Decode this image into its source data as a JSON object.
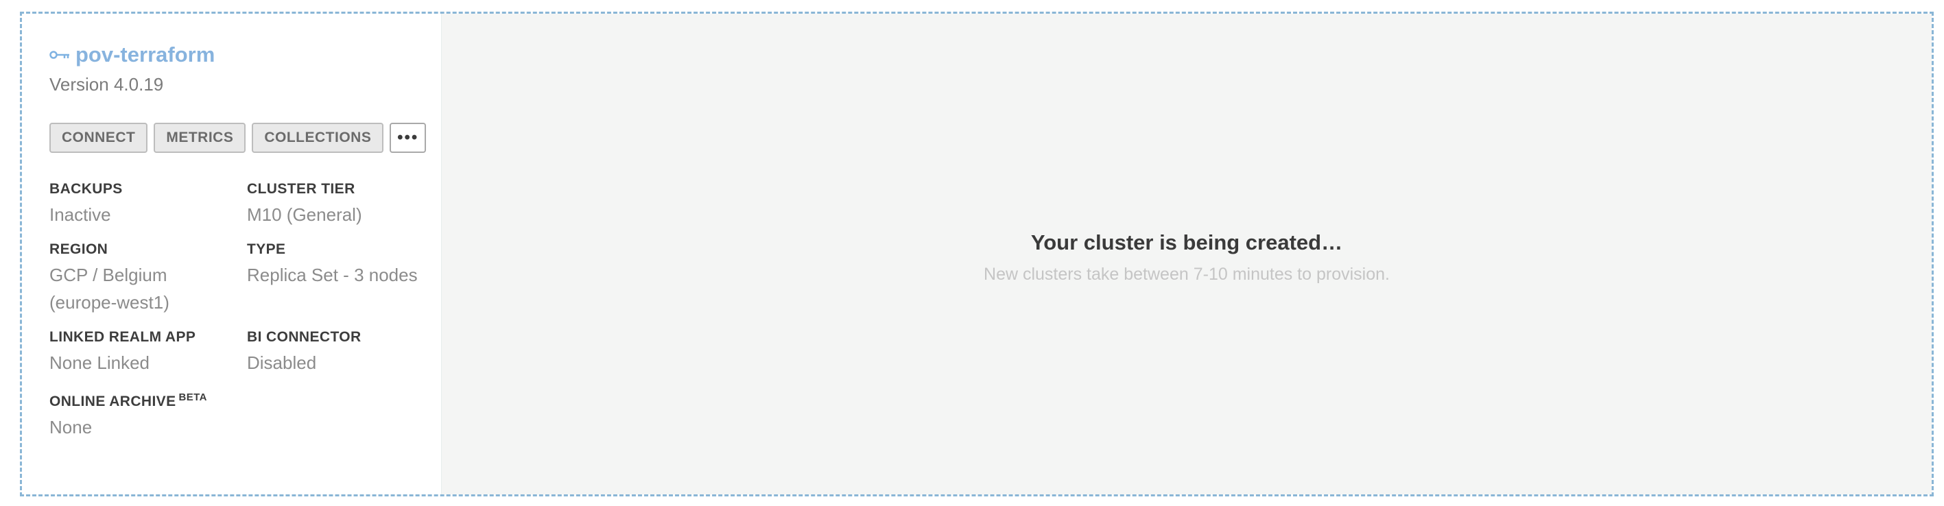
{
  "cluster": {
    "name": "pov-terraform",
    "version": "Version 4.0.19"
  },
  "buttons": {
    "connect": "CONNECT",
    "metrics": "METRICS",
    "collections": "COLLECTIONS",
    "more": "•••"
  },
  "info": {
    "backups": {
      "label": "BACKUPS",
      "value": "Inactive"
    },
    "cluster_tier": {
      "label": "CLUSTER TIER",
      "value": "M10 (General)"
    },
    "region": {
      "label": "REGION",
      "value": "GCP / Belgium (europe-west1)"
    },
    "type": {
      "label": "TYPE",
      "value": "Replica Set - 3 nodes"
    },
    "linked_realm_app": {
      "label": "LINKED REALM APP",
      "value": "None Linked"
    },
    "bi_connector": {
      "label": "BI CONNECTOR",
      "value": "Disabled"
    },
    "online_archive": {
      "label": "ONLINE ARCHIVE",
      "badge": "BETA",
      "value": "None"
    }
  },
  "status": {
    "title": "Your cluster is being created…",
    "subtitle": "New clusters take between 7-10 minutes to provision."
  },
  "colors": {
    "link": "#87b3de",
    "panel_bg": "#f4f5f4",
    "border_dashed": "#8ab6d6"
  }
}
